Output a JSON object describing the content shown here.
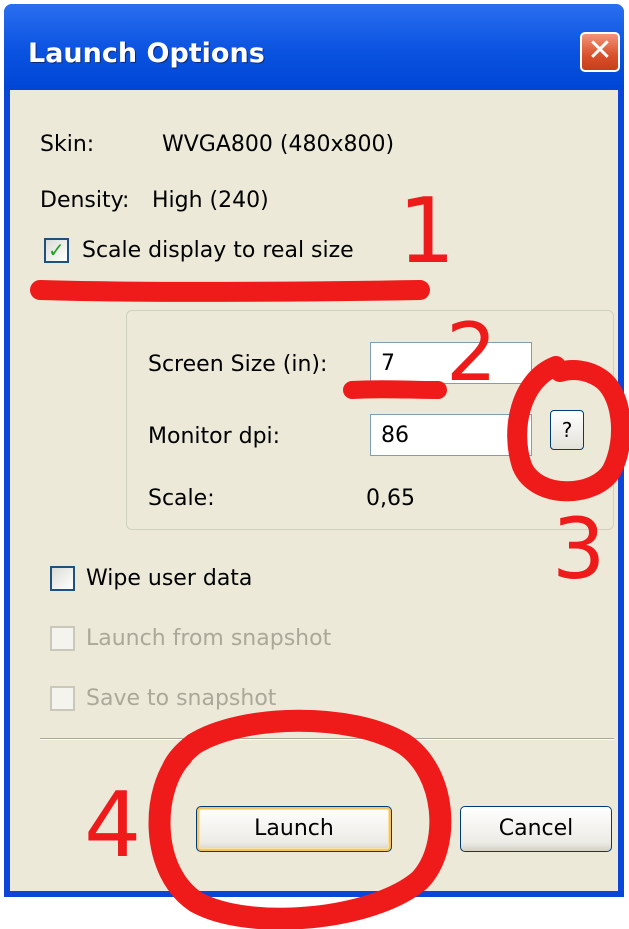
{
  "window": {
    "title": "Launch Options"
  },
  "info": {
    "skin_label": "Skin:",
    "skin_value": "WVGA800 (480x800)",
    "density_label": "Density:",
    "density_value": "High (240)"
  },
  "scale_checkbox": {
    "label": "Scale display to real size",
    "checked": true
  },
  "scale_group": {
    "screen_size_label": "Screen Size (in):",
    "screen_size_value": "7",
    "monitor_dpi_label": "Monitor dpi:",
    "monitor_dpi_value": "86",
    "help_label": "?",
    "scale_label": "Scale:",
    "scale_value": "0,65"
  },
  "options": {
    "wipe_label": "Wipe user data",
    "wipe_checked": false,
    "launch_snapshot_label": "Launch from snapshot",
    "launch_snapshot_enabled": false,
    "save_snapshot_label": "Save to snapshot",
    "save_snapshot_enabled": false
  },
  "buttons": {
    "launch": "Launch",
    "cancel": "Cancel"
  },
  "annotations": {
    "n1": "1",
    "n2": "2",
    "n3": "3",
    "n4": "4",
    "color": "#ef1b1b"
  },
  "colors": {
    "titlebar": "#0a52e0",
    "dialog_bg": "#ece9d8",
    "close_button": "#d9502b"
  }
}
